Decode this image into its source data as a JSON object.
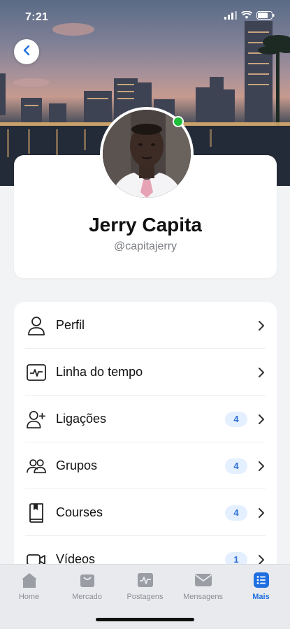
{
  "status_bar": {
    "time": "7:21"
  },
  "profile": {
    "name": "Jerry Capita",
    "handle": "@capitajerry",
    "online": true
  },
  "menu": {
    "items": [
      {
        "label": "Perfil",
        "icon": "user-icon",
        "badge": ""
      },
      {
        "label": "Linha do tempo",
        "icon": "activity-icon",
        "badge": ""
      },
      {
        "label": "Ligações",
        "icon": "user-add-icon",
        "badge": "4"
      },
      {
        "label": "Grupos",
        "icon": "group-icon",
        "badge": "4"
      },
      {
        "label": "Courses",
        "icon": "book-icon",
        "badge": "4"
      },
      {
        "label": "Vídeos",
        "icon": "video-icon",
        "badge": "1"
      }
    ]
  },
  "tabs": [
    {
      "label": "Home",
      "icon": "home-icon",
      "active": false
    },
    {
      "label": "Mercado",
      "icon": "market-icon",
      "active": false
    },
    {
      "label": "Postagens",
      "icon": "posts-icon",
      "active": false
    },
    {
      "label": "Mensagens",
      "icon": "mail-icon",
      "active": false
    },
    {
      "label": "Mais",
      "icon": "list-icon",
      "active": true
    }
  ],
  "colors": {
    "accent": "#1f6fe0",
    "badge_bg": "#e4efff",
    "badge_text": "#2f6fd6",
    "online": "#1fbf3a"
  }
}
